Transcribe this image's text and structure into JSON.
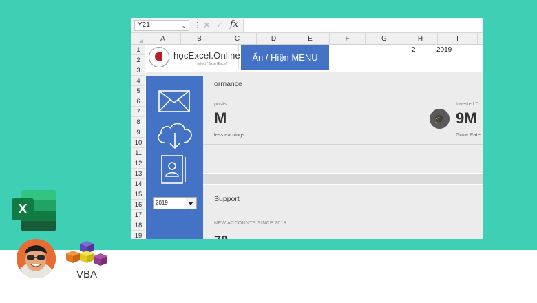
{
  "formula_bar": {
    "name_box": "Y21",
    "fx": "fx"
  },
  "columns": [
    "A",
    "B",
    "C",
    "D",
    "E",
    "F",
    "G",
    "H",
    "I"
  ],
  "rows": [
    "1",
    "2",
    "3",
    "4",
    "5",
    "6",
    "7",
    "8",
    "9",
    "10",
    "11",
    "12",
    "13",
    "14",
    "15",
    "16",
    "17",
    "18",
    "19"
  ],
  "header": {
    "logo_text": "họcExcel.Online",
    "logo_sub": "select * from [Excel]",
    "menu_button": "Ẩn / Hiện MENU",
    "g1_value": "2",
    "h1_value": "2019"
  },
  "dashboard": {
    "performance_title": "ormance",
    "deposits_label": "posits",
    "deposits_value": "M",
    "earnings_label": "less earnings",
    "invested_label": "Invested D",
    "invested_value": "9M",
    "grow_label": "Grow Rate",
    "support_title": "Support",
    "new_accounts_label": "NEW ACCOUNTS SINCE 2018",
    "new_accounts_partial": "78"
  },
  "sidebar": {
    "year_selected": "2019"
  },
  "branding": {
    "vba_label": "VBA"
  },
  "colors": {
    "background_teal": "#3ecfb4",
    "menu_blue": "#4472c4",
    "excel_green": "#107c41"
  }
}
